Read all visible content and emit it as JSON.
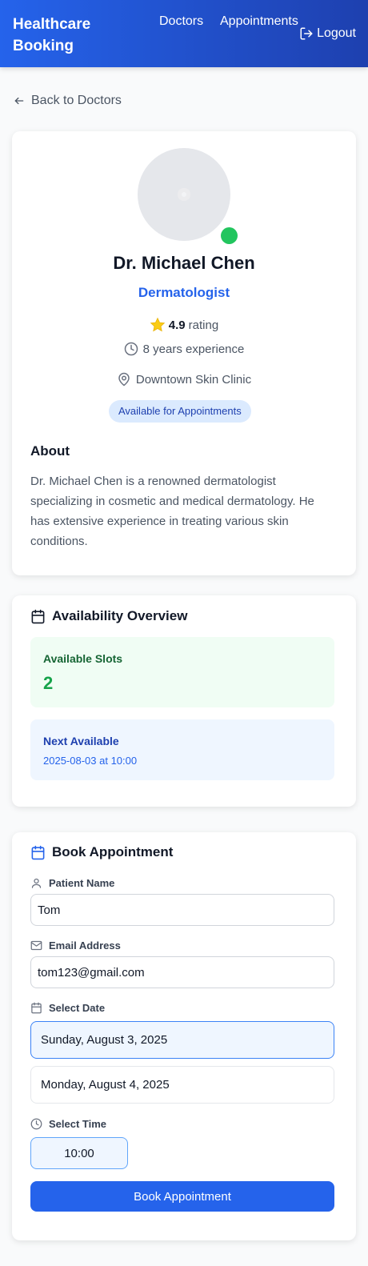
{
  "header": {
    "brand": "Healthcare Booking",
    "nav": [
      "Doctors",
      "Appointments"
    ],
    "logout_label": "Logout"
  },
  "back_label": "Back to Doctors",
  "doctor": {
    "name": "Dr. Michael Chen",
    "specialty": "Dermatologist",
    "rating_value": "4.9",
    "rating_suffix": "rating",
    "experience": "8 years experience",
    "location": "Downtown Skin Clinic",
    "availability_badge": "Available for Appointments",
    "about_title": "About",
    "about_text": "Dr. Michael Chen is a renowned dermatologist specializing in cosmetic and medical dermatology. He has extensive experience in treating various skin conditions."
  },
  "availability": {
    "title": "Availability Overview",
    "slots_label": "Available Slots",
    "slots_value": "2",
    "next_label": "Next Available",
    "next_value": "2025-08-03 at 10:00"
  },
  "booking": {
    "title": "Book Appointment",
    "name_label": "Patient Name",
    "name_value": "Tom",
    "email_label": "Email Address",
    "email_value": "tom123@gmail.com",
    "date_label": "Select Date",
    "dates": [
      "Sunday, August 3, 2025",
      "Monday, August 4, 2025"
    ],
    "time_label": "Select Time",
    "times": [
      "10:00"
    ],
    "submit_label": "Book Appointment"
  },
  "colors": {
    "primary": "#2563eb",
    "online": "#22c55e",
    "star": "#facc15"
  }
}
